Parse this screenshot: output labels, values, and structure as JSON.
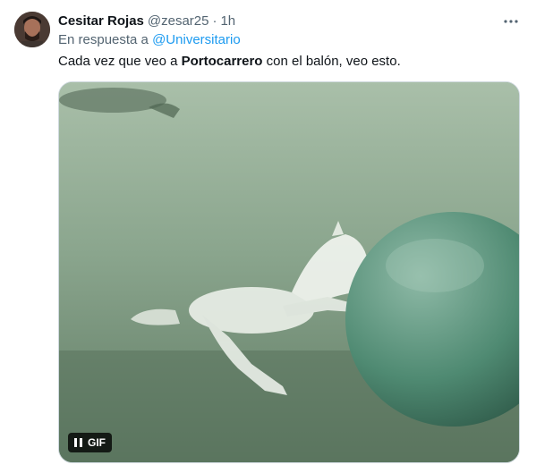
{
  "tweet": {
    "author_name": "Cesitar Rojas",
    "author_handle": "@zesar25",
    "separator": "·",
    "time": "1h",
    "reply_prefix": "En respuesta a",
    "reply_mention": "@Universitario",
    "text_before": "Cada vez que veo a ",
    "text_bold": "Portocarrero",
    "text_after": " con el balón, veo esto."
  },
  "media": {
    "badge_label": "GIF",
    "playback_state": "playing"
  },
  "icons": {
    "more": "more-icon",
    "pause": "pause-icon"
  },
  "colors": {
    "link": "#1d9bf0",
    "secondary_text": "#536471",
    "primary_text": "#0f1419"
  }
}
